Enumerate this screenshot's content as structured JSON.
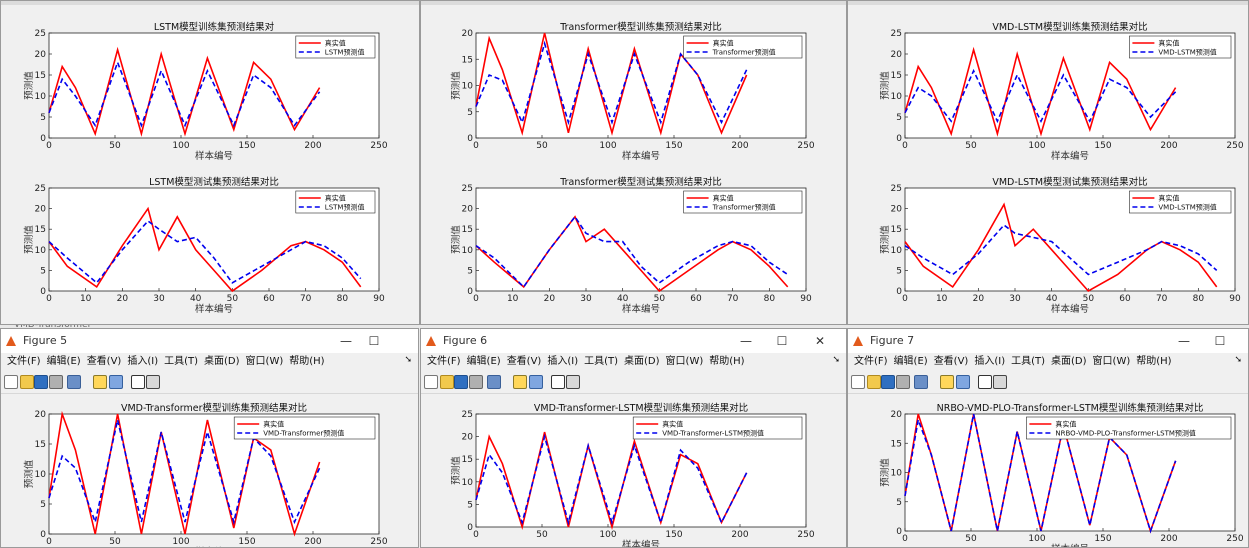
{
  "colors": {
    "true_line": "#ff0000",
    "pred_line": "#0000ee"
  },
  "menu_items": [
    "文件(F)",
    "编辑(E)",
    "查看(V)",
    "插入(I)",
    "工具(T)",
    "桌面(D)",
    "窗口(W)",
    "帮助(H)"
  ],
  "behind_window_label": "VMD-Transformer",
  "windows": [
    {
      "id": "w1",
      "plots": [
        {
          "title": "LSTM模型训练集预测结果对",
          "xlabel": "样本编号",
          "ylabel": "预测值",
          "legend": [
            "真实值",
            "LSTM预测值"
          ],
          "xlim": [
            0,
            250
          ],
          "xticks": [
            0,
            50,
            100,
            150,
            200,
            250
          ],
          "ylim": [
            0,
            25
          ],
          "yticks": [
            0,
            5,
            10,
            15,
            20,
            25
          ]
        },
        {
          "title": "LSTM模型测试集预测结果对比",
          "xlabel": "样本编号",
          "ylabel": "预测值",
          "legend": [
            "真实值",
            "LSTM预测值"
          ],
          "xlim": [
            0,
            90
          ],
          "xticks": [
            0,
            10,
            20,
            30,
            40,
            50,
            60,
            70,
            80,
            90
          ],
          "ylim": [
            0,
            25
          ],
          "yticks": [
            0,
            5,
            10,
            15,
            20,
            25
          ]
        }
      ]
    },
    {
      "id": "w2",
      "plots": [
        {
          "title": "Transformer模型训练集预测结果对比",
          "xlabel": "样本编号",
          "ylabel": "预测值",
          "legend": [
            "真实值",
            "Transformer预测值"
          ],
          "xlim": [
            0,
            250
          ],
          "xticks": [
            0,
            50,
            100,
            150,
            200,
            250
          ],
          "ylim": [
            0,
            20
          ],
          "yticks": [
            0,
            5,
            10,
            15,
            20
          ]
        },
        {
          "title": "Transformer模型测试集预测结果对比",
          "xlabel": "样本编号",
          "ylabel": "预测值",
          "legend": [
            "真实值",
            "Transformer预测值"
          ],
          "xlim": [
            0,
            90
          ],
          "xticks": [
            0,
            10,
            20,
            30,
            40,
            50,
            60,
            70,
            80,
            90
          ],
          "ylim": [
            0,
            25
          ],
          "yticks": [
            0,
            5,
            10,
            15,
            20,
            25
          ]
        }
      ]
    },
    {
      "id": "w3",
      "plots": [
        {
          "title": "VMD-LSTM模型训练集预测结果对比",
          "xlabel": "样本编号",
          "ylabel": "预测值",
          "legend": [
            "真实值",
            "VMD-LSTM预测值"
          ],
          "xlim": [
            0,
            250
          ],
          "xticks": [
            0,
            50,
            100,
            150,
            200,
            250
          ],
          "ylim": [
            0,
            25
          ],
          "yticks": [
            0,
            5,
            10,
            15,
            20,
            25
          ]
        },
        {
          "title": "VMD-LSTM模型测试集预测结果对比",
          "xlabel": "样本编号",
          "ylabel": "预测值",
          "legend": [
            "真实值",
            "VMD-LSTM预测值"
          ],
          "xlim": [
            0,
            90
          ],
          "xticks": [
            0,
            10,
            20,
            30,
            40,
            50,
            60,
            70,
            80,
            90
          ],
          "ylim": [
            0,
            25
          ],
          "yticks": [
            0,
            5,
            10,
            15,
            20,
            25
          ]
        }
      ]
    },
    {
      "id": "w4",
      "title": "Figure 5",
      "plots": [
        {
          "title": "VMD-Transformer模型训练集预测结果对比",
          "xlabel": "样本编号",
          "ylabel": "预测值",
          "legend": [
            "真实值",
            "VMD-Transformer预测值"
          ],
          "xlim": [
            0,
            250
          ],
          "xticks": [
            0,
            50,
            100,
            150,
            200,
            250
          ],
          "ylim": [
            0,
            20
          ],
          "yticks": [
            0,
            5,
            10,
            15,
            20
          ]
        }
      ]
    },
    {
      "id": "w5",
      "title": "Figure 6",
      "plots": [
        {
          "title": "VMD-Transformer-LSTM模型训练集预测结果对比",
          "xlabel": "样本编号",
          "ylabel": "预测值",
          "legend": [
            "真实值",
            "VMD-Transformer-LSTM预测值"
          ],
          "xlim": [
            0,
            250
          ],
          "xticks": [
            0,
            50,
            100,
            150,
            200,
            250
          ],
          "ylim": [
            0,
            25
          ],
          "yticks": [
            0,
            5,
            10,
            15,
            20,
            25
          ]
        }
      ]
    },
    {
      "id": "w6",
      "title": "Figure 7",
      "plots": [
        {
          "title": "NRBO-VMD-PLO-Transformer-LSTM模型训练集预测结果对比",
          "xlabel": "样本编号",
          "ylabel": "预测值",
          "legend": [
            "真实值",
            "NRBO-VMD-PLO-Transformer-LSTM预测值"
          ],
          "xlim": [
            0,
            250
          ],
          "xticks": [
            0,
            50,
            100,
            150,
            200,
            250
          ],
          "ylim": [
            0,
            20
          ],
          "yticks": [
            0,
            5,
            10,
            15,
            20
          ]
        }
      ]
    }
  ],
  "chart_data": [
    {
      "type": "line",
      "title": "LSTM模型训练集预测结果对",
      "xlabel": "样本编号",
      "ylabel": "预测值",
      "x": [
        0,
        10,
        20,
        35,
        52,
        70,
        85,
        103,
        120,
        140,
        155,
        168,
        186,
        205
      ],
      "series": [
        {
          "name": "真实值",
          "values": [
            6,
            17,
            12,
            1,
            21,
            1,
            20,
            1,
            19,
            2,
            18,
            14,
            2,
            12
          ]
        },
        {
          "name": "LSTM预测值",
          "values": [
            6,
            14,
            10,
            3,
            18,
            3,
            16,
            3,
            16,
            3,
            15,
            12,
            3,
            11
          ]
        }
      ]
    },
    {
      "type": "line",
      "title": "LSTM模型测试集预测结果对比",
      "xlabel": "样本编号",
      "ylabel": "预测值",
      "x": [
        0,
        5,
        13,
        20,
        27,
        30,
        35,
        40,
        45,
        50,
        58,
        66,
        70,
        75,
        80,
        85
      ],
      "series": [
        {
          "name": "真实值",
          "values": [
            12,
            6,
            1,
            11,
            20,
            10,
            18,
            10,
            5,
            0,
            5,
            11,
            12,
            10,
            7,
            1
          ]
        },
        {
          "name": "LSTM预测值",
          "values": [
            12,
            8,
            2,
            10,
            17,
            15,
            12,
            13,
            8,
            2,
            6,
            10,
            12,
            11,
            8,
            3
          ]
        }
      ]
    },
    {
      "type": "line",
      "title": "Transformer模型训练集预测结果对比",
      "xlabel": "样本编号",
      "ylabel": "预测值",
      "x": [
        0,
        10,
        20,
        35,
        52,
        70,
        85,
        103,
        120,
        140,
        155,
        168,
        186,
        205
      ],
      "series": [
        {
          "name": "真实值",
          "values": [
            6,
            19,
            13,
            1,
            20,
            1,
            17,
            1,
            17,
            1,
            16,
            12,
            1,
            12
          ]
        },
        {
          "name": "Transformer预测值",
          "values": [
            6,
            12,
            11,
            3,
            18,
            3,
            16,
            3,
            16,
            3,
            16,
            12,
            3,
            13
          ]
        }
      ]
    },
    {
      "type": "line",
      "title": "Transformer模型测试集预测结果对比",
      "xlabel": "样本编号",
      "ylabel": "预测值",
      "x": [
        0,
        5,
        13,
        20,
        27,
        30,
        35,
        40,
        45,
        50,
        58,
        66,
        70,
        75,
        80,
        85
      ],
      "series": [
        {
          "name": "真实值",
          "values": [
            11,
            7,
            1,
            10,
            18,
            12,
            15,
            10,
            5,
            0,
            5,
            10,
            12,
            10,
            6,
            1
          ]
        },
        {
          "name": "Transformer预测值",
          "values": [
            11,
            8,
            1,
            10,
            18,
            14,
            12,
            12,
            6,
            2,
            7,
            11,
            12,
            11,
            7,
            4
          ]
        }
      ]
    },
    {
      "type": "line",
      "title": "VMD-LSTM模型训练集预测结果对比",
      "xlabel": "样本编号",
      "ylabel": "预测值",
      "x": [
        0,
        10,
        20,
        35,
        52,
        70,
        85,
        103,
        120,
        140,
        155,
        168,
        186,
        205
      ],
      "series": [
        {
          "name": "真实值",
          "values": [
            6,
            17,
            12,
            1,
            21,
            1,
            20,
            1,
            19,
            2,
            18,
            14,
            2,
            12
          ]
        },
        {
          "name": "VMD-LSTM预测值",
          "values": [
            6,
            12,
            10,
            4,
            16,
            4,
            15,
            4,
            15,
            4,
            14,
            12,
            5,
            11
          ]
        }
      ]
    },
    {
      "type": "line",
      "title": "VMD-LSTM模型测试集预测结果对比",
      "xlabel": "样本编号",
      "ylabel": "预测值",
      "x": [
        0,
        5,
        13,
        20,
        27,
        30,
        35,
        40,
        45,
        50,
        58,
        66,
        70,
        75,
        80,
        85
      ],
      "series": [
        {
          "name": "真实值",
          "values": [
            12,
            6,
            1,
            10,
            21,
            11,
            15,
            10,
            5,
            0,
            4,
            10,
            12,
            10,
            7,
            1
          ]
        },
        {
          "name": "VMD-LSTM预测值",
          "values": [
            11,
            8,
            4,
            9,
            16,
            14,
            13,
            12,
            8,
            4,
            7,
            10,
            12,
            11,
            9,
            5
          ]
        }
      ]
    },
    {
      "type": "line",
      "title": "VMD-Transformer模型训练集预测结果对比",
      "xlabel": "样本编号",
      "ylabel": "预测值",
      "x": [
        0,
        10,
        20,
        35,
        52,
        70,
        85,
        103,
        120,
        140,
        155,
        168,
        186,
        205
      ],
      "series": [
        {
          "name": "真实值",
          "values": [
            6,
            20,
            14,
            0,
            20,
            0,
            17,
            0,
            19,
            1,
            16,
            14,
            0,
            12
          ]
        },
        {
          "name": "VMD-Transformer预测值",
          "values": [
            6,
            13,
            11,
            2,
            19,
            2,
            17,
            2,
            17,
            2,
            16,
            13,
            2,
            11
          ]
        }
      ]
    },
    {
      "type": "line",
      "title": "VMD-Transformer-LSTM模型训练集预测结果对比",
      "xlabel": "样本编号",
      "ylabel": "预测值",
      "x": [
        0,
        10,
        20,
        35,
        52,
        70,
        85,
        103,
        120,
        140,
        155,
        168,
        186,
        205
      ],
      "series": [
        {
          "name": "真实值",
          "values": [
            6,
            20,
            14,
            0,
            21,
            0,
            18,
            0,
            19,
            1,
            16,
            14,
            1,
            12
          ]
        },
        {
          "name": "VMD-Transformer-LSTM预测值",
          "values": [
            6,
            16,
            12,
            1,
            20,
            1,
            18,
            1,
            18,
            1,
            17,
            13,
            1,
            12
          ]
        }
      ]
    },
    {
      "type": "line",
      "title": "NRBO-VMD-PLO-Transformer-LSTM模型训练集预测结果对比",
      "xlabel": "样本编号",
      "ylabel": "预测值",
      "x": [
        0,
        10,
        20,
        35,
        52,
        70,
        85,
        103,
        120,
        140,
        155,
        168,
        186,
        205
      ],
      "series": [
        {
          "name": "真实值",
          "values": [
            6,
            20,
            13,
            0,
            20,
            0,
            17,
            0,
            18,
            1,
            16,
            13,
            0,
            12
          ]
        },
        {
          "name": "NRBO-VMD-PLO-Transformer-LSTM预测值",
          "values": [
            6,
            19,
            13,
            0,
            20,
            0,
            17,
            0,
            18,
            1,
            16,
            13,
            0,
            12
          ]
        }
      ]
    }
  ]
}
